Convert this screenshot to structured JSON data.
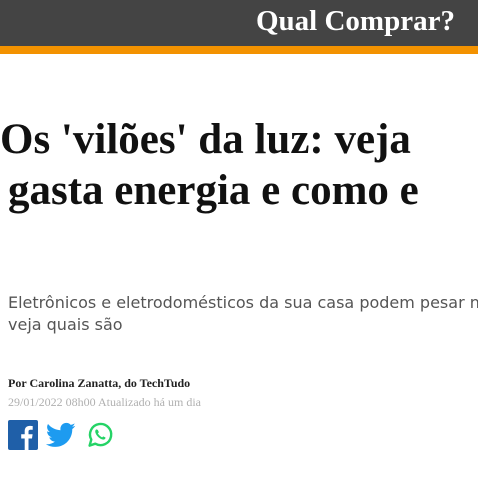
{
  "header": {
    "title": "Qual Comprar?",
    "bar_color": "#444444",
    "accent_color": "#f39200"
  },
  "article": {
    "headline_line1": "Os 'vilões' da luz: veja",
    "headline_line2": "gasta energia e como e",
    "subtitle_line1": "Eletrônicos e eletrodomésticos da sua casa podem pesar na",
    "subtitle_line2": "veja quais são",
    "byline": "Por Carolina Zanatta, do TechTudo",
    "dateline": "29/01/2022 08h00 Atualizado há um dia"
  },
  "share": {
    "icons": [
      "facebook-icon",
      "twitter-icon",
      "whatsapp-icon"
    ],
    "facebook_color": "#1f5fa8",
    "twitter_color": "#1d9bf0",
    "whatsapp_color": "#25d366"
  }
}
